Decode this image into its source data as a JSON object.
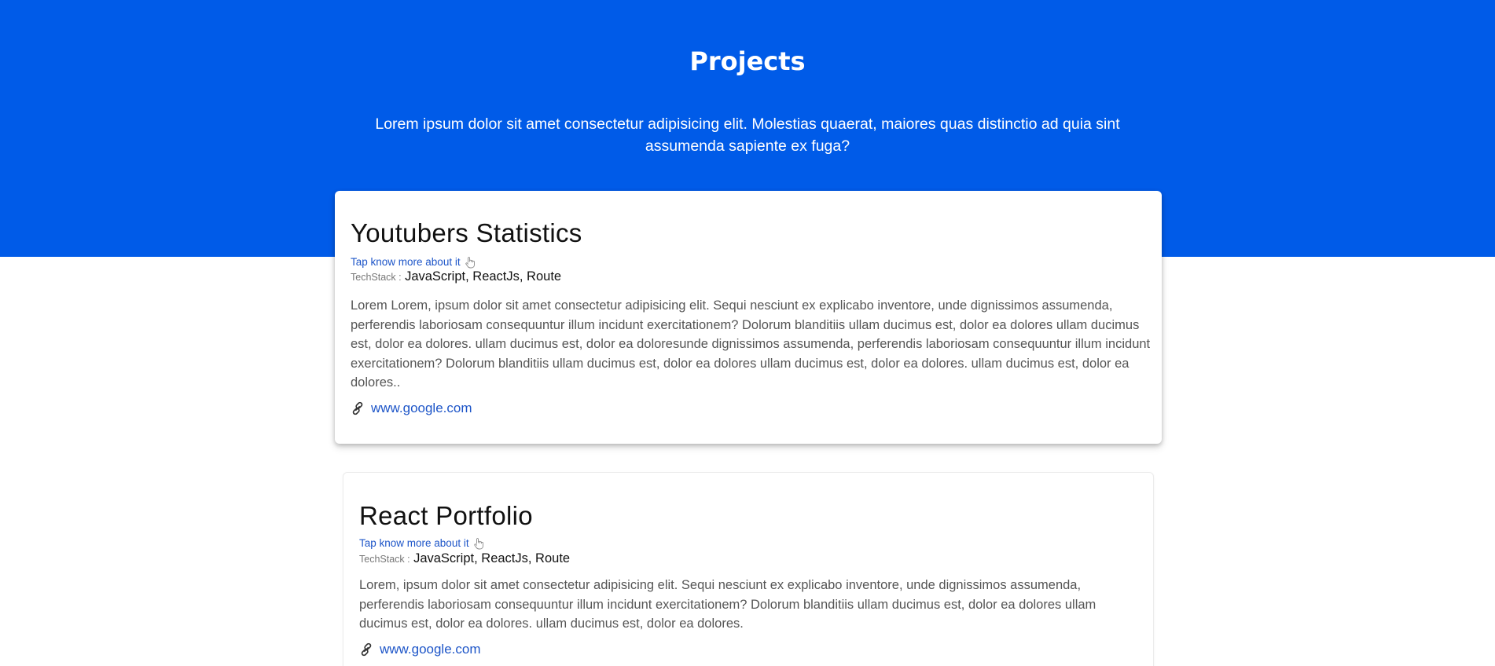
{
  "header": {
    "title": "Projects",
    "description": "Lorem ipsum dolor sit amet consectetur adipisicing elit. Molestias quaerat, maiores quas distinctio ad quia sint assumenda sapiente ex fuga?"
  },
  "colors": {
    "hero_background": "#005be8",
    "link": "#1d55c8"
  },
  "projects": [
    {
      "title": "Youtubers Statistics",
      "tap_text": "Tap know more about it",
      "tap_icon": "pointing-hand-icon",
      "techstack_label": "TechStack :",
      "techstack_value": "JavaScript, ReactJs, Route",
      "description": "Lorem Lorem, ipsum dolor sit amet consectetur adipisicing elit. Sequi nesciunt ex explicabo inventore, unde dignissimos assumenda, perferendis laboriosam consequuntur illum incidunt exercitationem? Dolorum blanditiis ullam ducimus est, dolor ea dolores ullam ducimus est, dolor ea dolores. ullam ducimus est, dolor ea doloresunde dignissimos assumenda, perferendis laboriosam consequuntur illum incidunt exercitationem? Dolorum blanditiis ullam ducimus est, dolor ea dolores ullam ducimus est, dolor ea dolores. ullam ducimus est, dolor ea dolores..",
      "link_icon": "link-icon",
      "link": "www.google.com"
    },
    {
      "title": "React Portfolio",
      "tap_text": "Tap know more about it",
      "tap_icon": "pointing-hand-icon",
      "techstack_label": "TechStack :",
      "techstack_value": "JavaScript, ReactJs, Route",
      "description": "Lorem, ipsum dolor sit amet consectetur adipisicing elit. Sequi nesciunt ex explicabo inventore, unde dignissimos assumenda, perferendis laboriosam consequuntur illum incidunt exercitationem? Dolorum blanditiis ullam ducimus est, dolor ea dolores ullam ducimus est, dolor ea dolores. ullam ducimus est, dolor ea dolores.",
      "link_icon": "link-icon",
      "link": "www.google.com"
    }
  ]
}
